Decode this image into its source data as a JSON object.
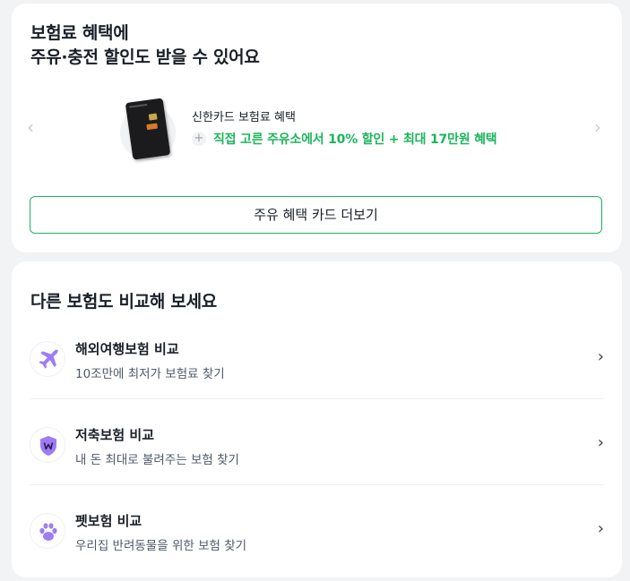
{
  "promo": {
    "title_line1": "보험료 혜택에",
    "title_line2": "주유·충전 할인도 받을 수 있어요",
    "prev_arrow": "‹",
    "next_arrow": "›",
    "card_name": "신한카드 보험료 혜택",
    "plus_icon": "+",
    "benefit_text": "직접 고른 주유소에서 10% 할인 + 최대 17만원 혜택",
    "more_button_label": "주유 혜택 카드 더보기",
    "accent_color": "#1bb55c"
  },
  "compare": {
    "title": "다른 보험도 비교해 보세요",
    "items": [
      {
        "icon": "airplane-icon",
        "title": "해외여행보험 비교",
        "subtitle": "10조만에 최저가 보험료 찾기"
      },
      {
        "icon": "shield-w-icon",
        "title": "저축보험 비교",
        "subtitle": "내 돈 최대로 불려주는 보험 찾기"
      },
      {
        "icon": "paw-icon",
        "title": "펫보험 비교",
        "subtitle": "우리집 반려동물을 위한 보험 찾기"
      }
    ],
    "chevron": "›",
    "icon_color": "#9d7cf5"
  }
}
